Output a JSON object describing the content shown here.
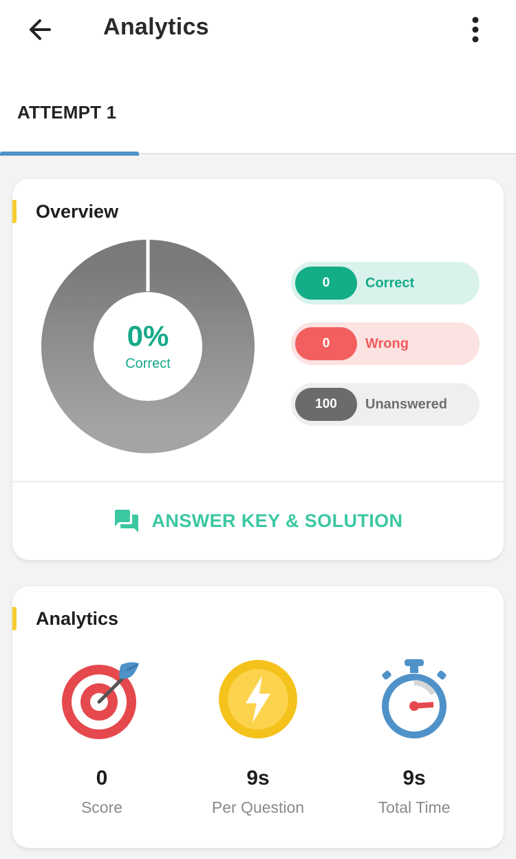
{
  "header": {
    "title": "Analytics",
    "back_icon": "arrow-left-icon",
    "menu_icon": "more-vertical-icon"
  },
  "tabs": [
    {
      "label": "ATTEMPT 1",
      "active": true
    }
  ],
  "overview": {
    "title": "Overview",
    "donut": {
      "percent_text": "0%",
      "subtitle": "Correct",
      "correct_fraction": 0,
      "wrong_fraction": 0,
      "unanswered_fraction": 1
    },
    "stats": [
      {
        "value": "0",
        "label": "Correct",
        "badge_color": "#13ad88",
        "bg_color": "#d9f3ec",
        "text_color": "#16a98a"
      },
      {
        "value": "0",
        "label": "Wrong",
        "badge_color": "#f35f5f",
        "bg_color": "#fde2e2",
        "text_color": "#ef5a5a"
      },
      {
        "value": "100",
        "label": "Unanswered",
        "badge_color": "#6b6b6b",
        "bg_color": "#efefef",
        "text_color": "#6e6e6e"
      }
    ],
    "answer_key_label": "ANSWER KEY & SOLUTION",
    "answer_key_icon": "chat-bubbles-icon"
  },
  "analytics": {
    "title": "Analytics",
    "items": [
      {
        "icon": "target-dart-icon",
        "value": "0",
        "label": "Score"
      },
      {
        "icon": "lightning-coin-icon",
        "value": "9s",
        "label": "Per Question"
      },
      {
        "icon": "stopwatch-icon",
        "value": "9s",
        "label": "Total Time"
      }
    ]
  },
  "colors": {
    "accent_blue": "#4e92c9",
    "section_accent": "#f6cd2f",
    "teal": "#3cc7a3"
  }
}
